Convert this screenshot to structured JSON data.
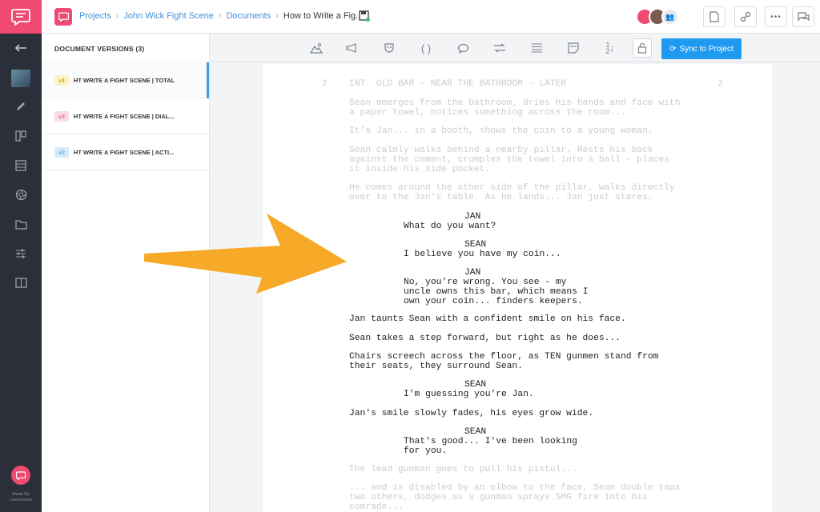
{
  "rail": {
    "made_by": "Made By",
    "made_by_brand": "Leanometry"
  },
  "header": {
    "breadcrumbs": [
      "Projects",
      "John Wick Fight Scene",
      "Documents"
    ],
    "current": "How to Write a Fig.."
  },
  "versions": {
    "title": "DOCUMENT VERSIONS (3)",
    "items": [
      {
        "tag": "v4",
        "label": "HT WRITE A FIGHT SCENE | TOTAL",
        "tag_bg": "#fbf3c2",
        "tag_fg": "#b99b1a"
      },
      {
        "tag": "v3",
        "label": "HT WRITE A FIGHT SCENE | DIAL...",
        "tag_bg": "#fbdbe6",
        "tag_fg": "#d24d7a"
      },
      {
        "tag": "v2",
        "label": "HT WRITE A FIGHT SCENE | ACTI...",
        "tag_bg": "#d3ecfb",
        "tag_fg": "#3b8fc9"
      }
    ]
  },
  "toolbar": {
    "sync_label": "Sync to Project"
  },
  "script": {
    "scene_number": "2",
    "heading": "INT. OLD BAR - NEAR THE BATHROOM - LATER",
    "a1": [
      "Sean emerges from the bathroom, dries his hands and face with",
      "a paper towel, notices something across the room..."
    ],
    "a2": [
      "It's Jan... in a booth, shows the coin to a young woman."
    ],
    "a3": [
      "Sean calmly walks behind a nearby pillar. Rests his back",
      "against the cement, crumples the towel into a ball - places",
      "it inside his side pocket."
    ],
    "a4": [
      "He comes around the other side of the pillar, walks directly",
      "over to the Jan's table. As he lands... Jan just stares."
    ],
    "c1": "JAN",
    "d1": [
      "What do you want?"
    ],
    "c2": "SEAN",
    "d2": [
      "I believe you have my coin..."
    ],
    "c3": "JAN",
    "d3": [
      "No, you're wrong. You see - my",
      "uncle owns this bar, which means I",
      "own your coin... finders keepers."
    ],
    "a5": [
      "Jan taunts Sean with a confident smile on his face."
    ],
    "a6": [
      "Sean takes a step forward, but right as he does..."
    ],
    "a7": [
      "Chairs screech across the floor, as TEN gunmen stand from",
      "their seats, they surround Sean."
    ],
    "c4": "SEAN",
    "d4": [
      "I'm guessing you're Jan."
    ],
    "a8": [
      "Jan's smile slowly fades, his eyes grow wide."
    ],
    "c5": "SEAN",
    "d5": [
      "That's good... I've been looking",
      "for you."
    ],
    "a9": [
      "The lead gunman goes to pull his pistol..."
    ],
    "a10": [
      "... and is disabled by an elbow to the face, Sean double taps",
      "two others, dodges as a gunman sprays SMG fire into his",
      "comrade..."
    ]
  },
  "colors": {
    "brand": "#ee4a72",
    "accent": "#1e9af0",
    "arrow": "#f7a928"
  }
}
